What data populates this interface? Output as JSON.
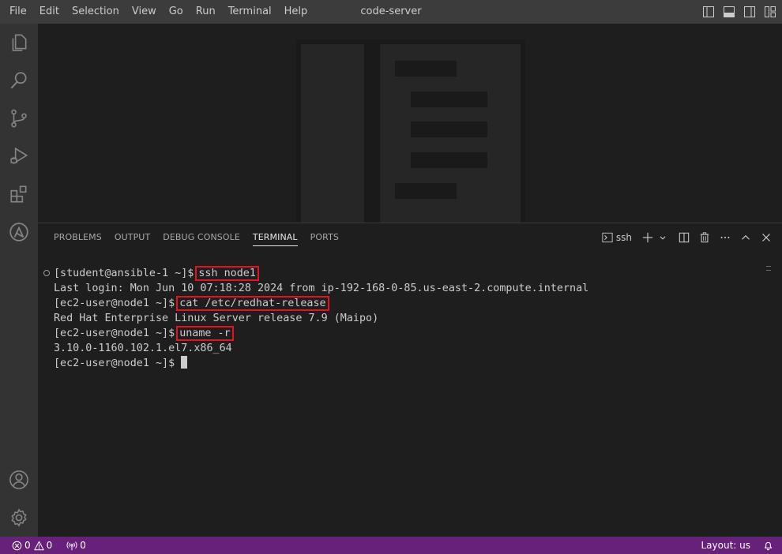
{
  "titlebar": {
    "menu": [
      "File",
      "Edit",
      "Selection",
      "View",
      "Go",
      "Run",
      "Terminal",
      "Help"
    ],
    "title": "code-server"
  },
  "activitybar": {
    "icons": [
      "explorer-icon",
      "search-icon",
      "source-control-icon",
      "run-debug-icon",
      "extensions-icon",
      "ansible-icon",
      "accounts-icon",
      "manage-gear-icon"
    ]
  },
  "panel": {
    "tabs": [
      "PROBLEMS",
      "OUTPUT",
      "DEBUG CONSOLE",
      "TERMINAL",
      "PORTS"
    ],
    "active_tab": "TERMINAL",
    "terminal_name": "ssh"
  },
  "terminal": {
    "lines": [
      {
        "prompt": "[student@ansible-1 ~]$",
        "command": "ssh node1"
      },
      {
        "output": "Last login: Mon Jun 10 07:18:28 2024 from ip-192-168-0-85.us-east-2.compute.internal"
      },
      {
        "prompt": "[ec2-user@node1 ~]$",
        "command": "cat /etc/redhat-release"
      },
      {
        "output": "Red Hat Enterprise Linux Server release 7.9 (Maipo)"
      },
      {
        "prompt": "[ec2-user@node1 ~]$",
        "command": "uname -r"
      },
      {
        "output": "3.10.0-1160.102.1.el7.x86_64"
      },
      {
        "prompt": "[ec2-user@node1 ~]$",
        "command": ""
      }
    ]
  },
  "statusbar": {
    "errors": "0",
    "warnings": "0",
    "ports": "0",
    "layout": "Layout: us"
  },
  "colors": {
    "statusbar": "#68217a",
    "highlight_box": "#e81123"
  }
}
